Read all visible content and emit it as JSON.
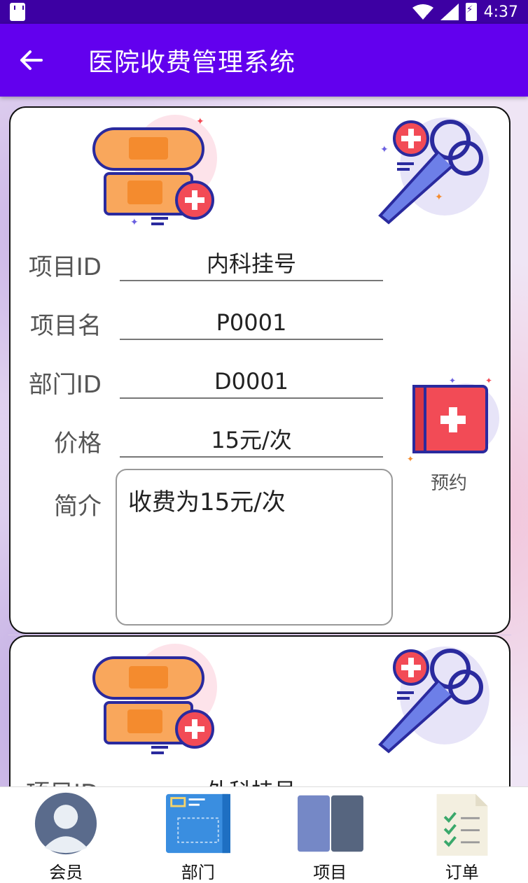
{
  "status_bar": {
    "time": "4:37"
  },
  "app_bar": {
    "title": "医院收费管理系统"
  },
  "card1": {
    "fields": [
      {
        "label": "项目ID",
        "value": "内科挂号"
      },
      {
        "label": "项目名",
        "value": "P0001"
      },
      {
        "label": "部门ID",
        "value": "D0001"
      },
      {
        "label": "价格",
        "value": "15元/次"
      }
    ],
    "description_label": "简介",
    "description": "收费为15元/次",
    "book_label": "预约"
  },
  "card2": {
    "first_label": "项目ID",
    "first_value": "外科挂号"
  },
  "bottom_nav": [
    {
      "label": "会员",
      "icon": "member-avatar-icon"
    },
    {
      "label": "部门",
      "icon": "department-board-icon"
    },
    {
      "label": "项目",
      "icon": "project-book-icon"
    },
    {
      "label": "订单",
      "icon": "order-checklist-icon"
    }
  ],
  "colors": {
    "status_bar": "#3d00a3",
    "app_bar": "#6200ee"
  }
}
